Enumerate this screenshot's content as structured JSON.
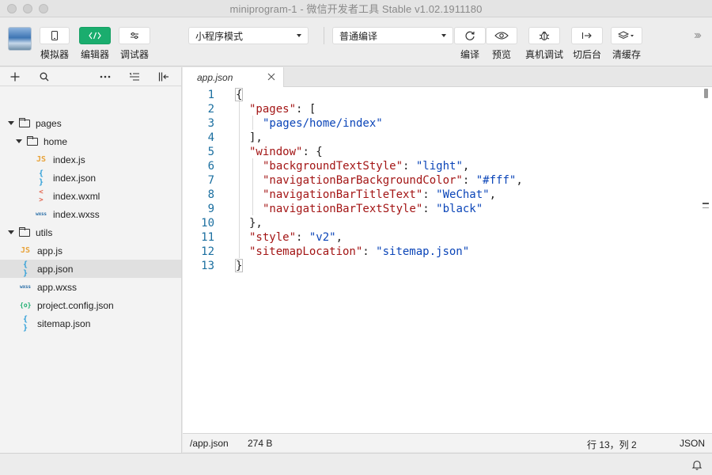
{
  "window": {
    "title": "miniprogram-1 - 微信开发者工具 Stable v1.02.1911180"
  },
  "toolbar": {
    "simulator_label": "模拟器",
    "editor_label": "编辑器",
    "debugger_label": "调试器",
    "mode_select": "小程序模式",
    "compile_select": "普通编译",
    "compile_label": "编译",
    "preview_label": "预览",
    "device_debug_label": "真机调试",
    "background_label": "切后台",
    "clear_cache_label": "清缓存"
  },
  "sidebar": {
    "tree": [
      {
        "name": "pages",
        "type": "folder"
      },
      {
        "name": "home",
        "type": "folder"
      },
      {
        "name": "index.js",
        "type": "js"
      },
      {
        "name": "index.json",
        "type": "json"
      },
      {
        "name": "index.wxml",
        "type": "wxml"
      },
      {
        "name": "index.wxss",
        "type": "wxss"
      },
      {
        "name": "utils",
        "type": "folder"
      },
      {
        "name": "app.js",
        "type": "js"
      },
      {
        "name": "app.json",
        "type": "json",
        "selected": true
      },
      {
        "name": "app.wxss",
        "type": "wxss"
      },
      {
        "name": "project.config.json",
        "type": "project"
      },
      {
        "name": "sitemap.json",
        "type": "json"
      }
    ],
    "icons": {
      "js": "JS",
      "json": "{ }",
      "wxml": "< >",
      "wxss": "wxss",
      "project": "{o}"
    }
  },
  "editor": {
    "tab_name": "app.json",
    "line_numbers": [
      "1",
      "2",
      "3",
      "4",
      "5",
      "6",
      "7",
      "8",
      "9",
      "10",
      "11",
      "12",
      "13"
    ],
    "lines": {
      "l1": "{",
      "l2_key": "\"pages\"",
      "l2_rest": ": [",
      "l3_val": "\"pages/home/index\"",
      "l4": "],",
      "l5_key": "\"window\"",
      "l5_rest": ": {",
      "l6_key": "\"backgroundTextStyle\"",
      "l6_sep": ": ",
      "l6_val": "\"light\"",
      "l6_end": ",",
      "l7_key": "\"navigationBarBackgroundColor\"",
      "l7_sep": ": ",
      "l7_val": "\"#fff\"",
      "l7_end": ",",
      "l8_key": "\"navigationBarTitleText\"",
      "l8_sep": ": ",
      "l8_val": "\"WeChat\"",
      "l8_end": ",",
      "l9_key": "\"navigationBarTextStyle\"",
      "l9_sep": ": ",
      "l9_val": "\"black\"",
      "l10": "},",
      "l11_key": "\"style\"",
      "l11_sep": ": ",
      "l11_val": "\"v2\"",
      "l11_end": ",",
      "l12_key": "\"sitemapLocation\"",
      "l12_sep": ": ",
      "l12_val": "\"sitemap.json\"",
      "l13": "}"
    }
  },
  "statusbar": {
    "path": "/app.json",
    "size": "274 B",
    "position": "行 13，列 2",
    "language": "JSON"
  },
  "colors": {
    "accent_green": "#1aad6e",
    "json_key": "#a31515",
    "json_string": "#0b45b8",
    "line_number": "#1b6fa0"
  }
}
